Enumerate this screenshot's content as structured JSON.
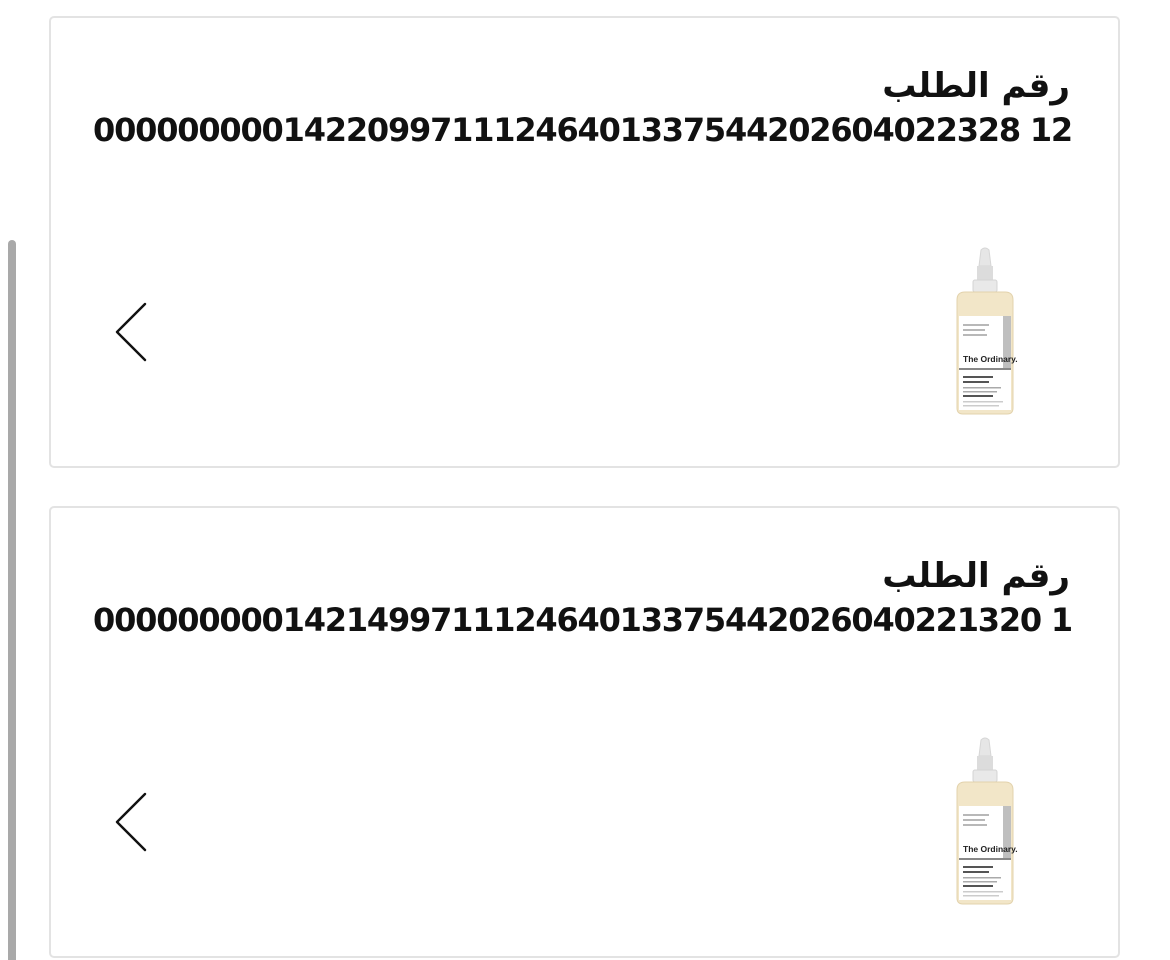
{
  "orders": [
    {
      "label": "رقم الطلب",
      "number": "00000000014220997111246401337544202604022328 12",
      "product_brand": "The Ordinary.",
      "chevron_icon": "chevron-left-icon"
    },
    {
      "label": "رقم الطلب",
      "number": "000000000142149971112464013375442026040221320 1",
      "product_brand": "The Ordinary.",
      "chevron_icon": "chevron-left-icon"
    }
  ],
  "colors": {
    "card_border": "#e3e3e3",
    "text": "#111111",
    "scrollbar": "#a9a9a9"
  }
}
